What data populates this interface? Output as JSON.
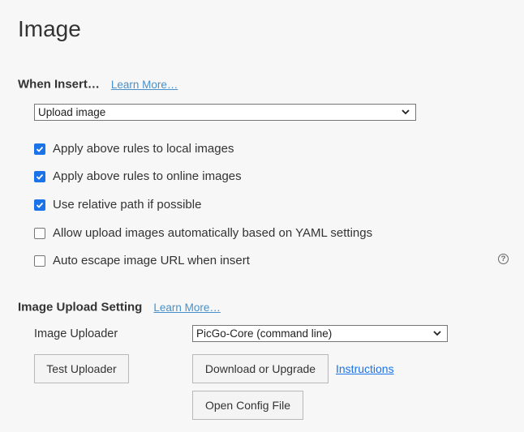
{
  "page": {
    "title": "Image"
  },
  "when_insert": {
    "heading": "When Insert…",
    "learn_more": "Learn More…",
    "select_value": "Upload image",
    "options": [
      {
        "label": "Apply above rules to local images",
        "checked": true
      },
      {
        "label": "Apply above rules to online images",
        "checked": true
      },
      {
        "label": "Use relative path if possible",
        "checked": true
      },
      {
        "label": "Allow upload images automatically based on YAML settings",
        "checked": false
      },
      {
        "label": "Auto escape image URL when insert",
        "checked": false
      }
    ],
    "help_glyph": "?"
  },
  "upload_setting": {
    "heading": "Image Upload Setting",
    "learn_more": "Learn More…",
    "uploader_label": "Image Uploader",
    "uploader_value": "PicGo-Core (command line)",
    "test_button": "Test Uploader",
    "download_button": "Download or Upgrade",
    "instructions_link": "Instructions",
    "config_button": "Open Config File"
  },
  "colors": {
    "accent": "#1a73e8",
    "link": "#4a90c8",
    "background": "#f7f7f7"
  },
  "icons": {
    "dropdown": "chevron-down-icon",
    "checkbox": "check-icon",
    "help": "help-circle-icon"
  }
}
